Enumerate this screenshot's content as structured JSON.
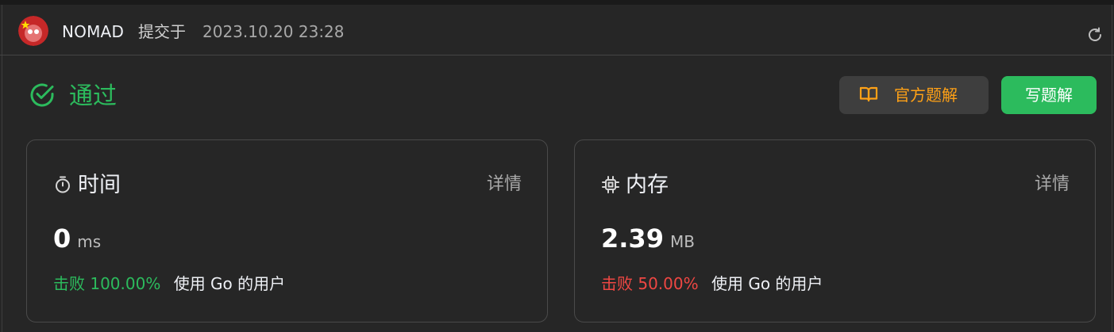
{
  "header": {
    "author": "NOMAD",
    "submit_text": "提交于",
    "submit_time": "2023.10.20 23:28"
  },
  "status": {
    "label": "通过",
    "color": "#2cbb5d"
  },
  "buttons": {
    "official_solution": "官方题解",
    "write_solution": "写题解"
  },
  "metrics": {
    "time": {
      "title": "时间",
      "detail": "详情",
      "value": "0",
      "unit": "ms",
      "beat_label": "击败",
      "beat_percent": "100.00%",
      "beat_suffix": "使用 Go 的用户",
      "icon": "stopwatch-icon"
    },
    "memory": {
      "title": "内存",
      "detail": "详情",
      "value": "2.39",
      "unit": "MB",
      "beat_label": "击败",
      "beat_percent": "50.00%",
      "beat_suffix": "使用 Go 的用户",
      "icon": "chip-icon"
    }
  },
  "colors": {
    "accent_green": "#2cbb5d",
    "accent_orange": "#ffa116",
    "accent_red": "#ef4743",
    "background": "#262626"
  }
}
